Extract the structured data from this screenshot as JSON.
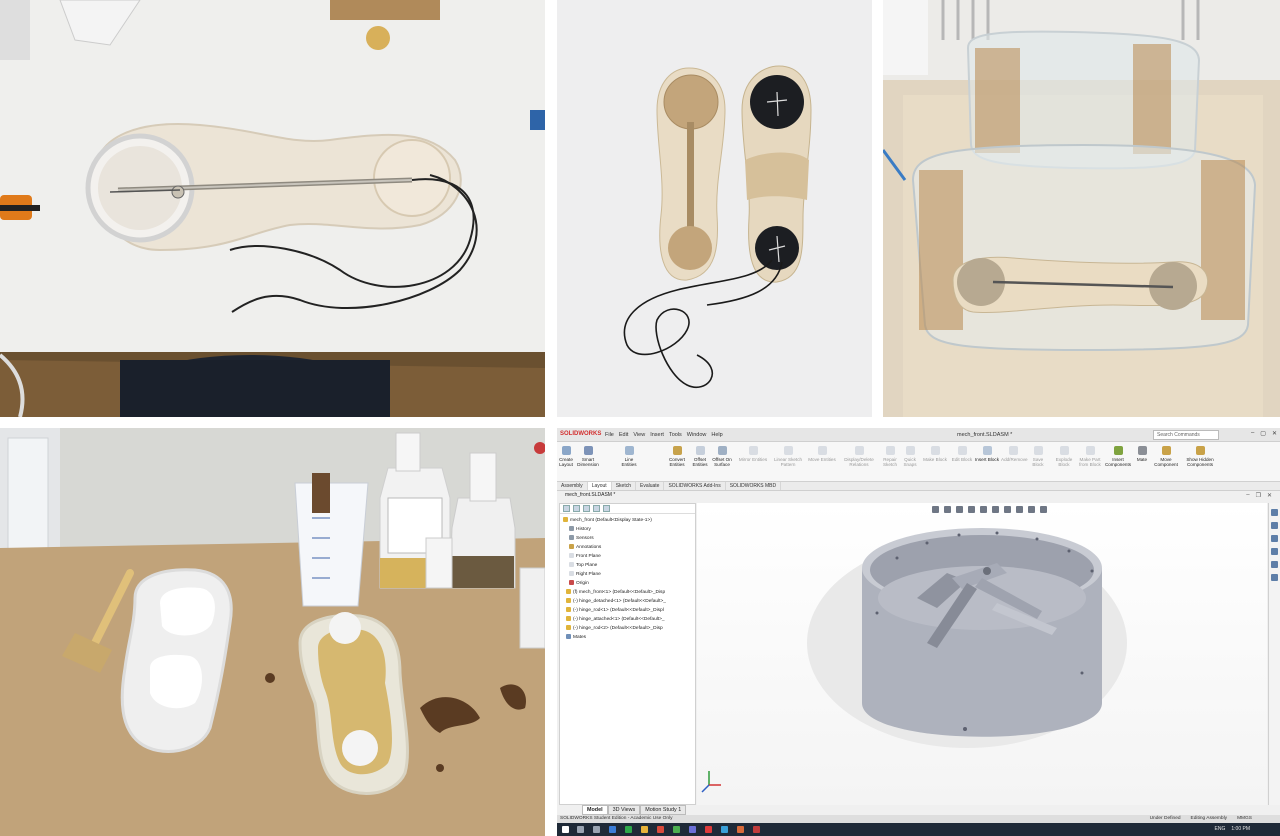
{
  "photos": {
    "top_left": {
      "label": "foam insole with silicone ring and wire"
    },
    "top_center": {
      "label": "two wooden insoles with discs"
    },
    "top_right": {
      "label": "acetate mold walls around insole"
    },
    "bottom_left": {
      "label": "silicone casting with resin bottles"
    }
  },
  "solidworks": {
    "brand": "SOLIDWORKS",
    "menus": [
      "File",
      "Edit",
      "View",
      "Insert",
      "Tools",
      "Window",
      "Help"
    ],
    "window_title": "mech_front.SLDASM *",
    "search_placeholder": "Search Commands",
    "ribbon": [
      "Create Layout",
      "Smart Dimension",
      "Line Entities",
      "Convert Entities",
      "Offset Entities",
      "Offset On Surface",
      "Mirror Entities",
      "Linear Sketch Pattern",
      "Move Entities",
      "Display/Delete Relations",
      "Repair Sketch",
      "Quick Snaps",
      "Make Block",
      "Edit Block",
      "Insert Block",
      "Add/Remove",
      "Save Block",
      "Explode Block",
      "Make Part from Block",
      "Insert Components",
      "Mate",
      "Move Component",
      "Show Hidden Components"
    ],
    "cm_tabs": [
      "Assembly",
      "Layout",
      "Sketch",
      "Evaluate",
      "SOLIDWORKS Add-Ins",
      "SOLIDWORKS MBD"
    ],
    "doc_tab": "mech_front.SLDASM *",
    "tree": [
      "mech_front  (Default<Display State-1>)",
      "History",
      "Sensors",
      "Annotations",
      "Front Plane",
      "Top Plane",
      "Right Plane",
      "Origin",
      "(f) mech_front<1> (Default<<Default>_Disp",
      "(-) hinge_detached<1> (Default<<Default>_",
      "(-) hinge_rod<1> (Default<<Default>_Displ",
      "(-) hinge_attached<1> (Default<<Default>_",
      "(-) hinge_rod<2> (Default<<Default>_Disp",
      "Mates"
    ],
    "bottom_tabs": [
      "Model",
      "3D Views",
      "Motion Study 1"
    ],
    "status_left": "SOLIDWORKS Student Edition - Academic Use Only",
    "status_mid": "Under Defined",
    "status_edit": "Editing Assembly",
    "status_units": "MMGS",
    "taskbar_lang": "ENG",
    "taskbar_time": "1:00 PM"
  }
}
